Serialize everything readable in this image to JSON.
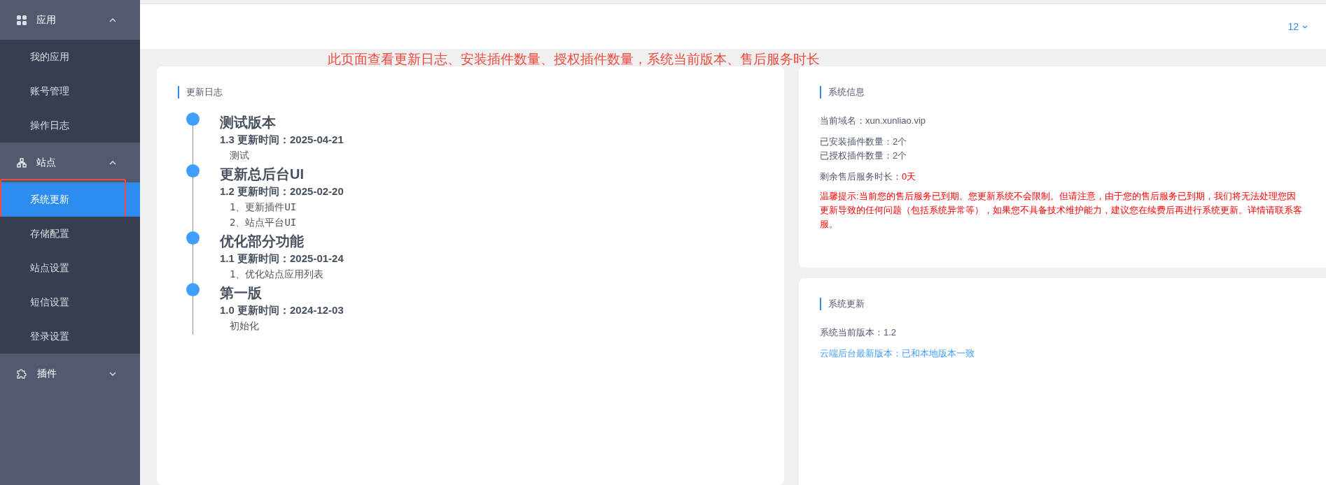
{
  "sidebar": {
    "groups": [
      {
        "label": "应用",
        "expanded": true,
        "items": [
          {
            "label": "我的应用",
            "selected": false
          },
          {
            "label": "账号管理",
            "selected": false
          },
          {
            "label": "操作日志",
            "selected": false
          }
        ]
      },
      {
        "label": "站点",
        "expanded": true,
        "items": [
          {
            "label": "系统更新",
            "selected": true
          },
          {
            "label": "存储配置",
            "selected": false
          },
          {
            "label": "站点设置",
            "selected": false
          },
          {
            "label": "短信设置",
            "selected": false
          },
          {
            "label": "登录设置",
            "selected": false
          }
        ]
      },
      {
        "label": "插件",
        "expanded": false
      }
    ]
  },
  "header": {
    "page_size": "12"
  },
  "annotation": "此页面查看更新日志、安装插件数量、授权插件数量，系统当前版本、售后服务时长",
  "changelog": {
    "title": "更新日志",
    "entries": [
      {
        "title": "测试版本",
        "version_line": "1.3 更新时间：2025-04-21",
        "notes": [
          "测试"
        ]
      },
      {
        "title": "更新总后台UI",
        "version_line": "1.2 更新时间：2025-02-20",
        "notes": [
          "1、更新插件UI",
          "2、站点平台UI"
        ]
      },
      {
        "title": "优化部分功能",
        "version_line": "1.1 更新时间：2025-01-24",
        "notes": [
          "1、优化站点应用列表"
        ]
      },
      {
        "title": "第一版",
        "version_line": "1.0 更新时间：2024-12-03",
        "notes": [
          "初始化"
        ]
      }
    ]
  },
  "system_info": {
    "title": "系统信息",
    "domain": "当前域名：xun.xunliao.vip",
    "installed_plugins": "已安装插件数量：2个",
    "authorized_plugins": "已授权插件数量：2个",
    "service_label": "剩余售后服务时长：",
    "service_value": "0天",
    "warning": "温馨提示:当前您的售后服务已到期。您更新系统不会限制。但请注意，由于您的售后服务已到期，我们将无法处理您因更新导致的任何问题（包括系统异常等），如果您不具备技术维护能力，建议您在续费后再进行系统更新。详情请联系客服。"
  },
  "system_update": {
    "title": "系统更新",
    "current_version": "系统当前版本：1.2",
    "cloud_version": "云端后台最新版本：已和本地版本一致"
  }
}
